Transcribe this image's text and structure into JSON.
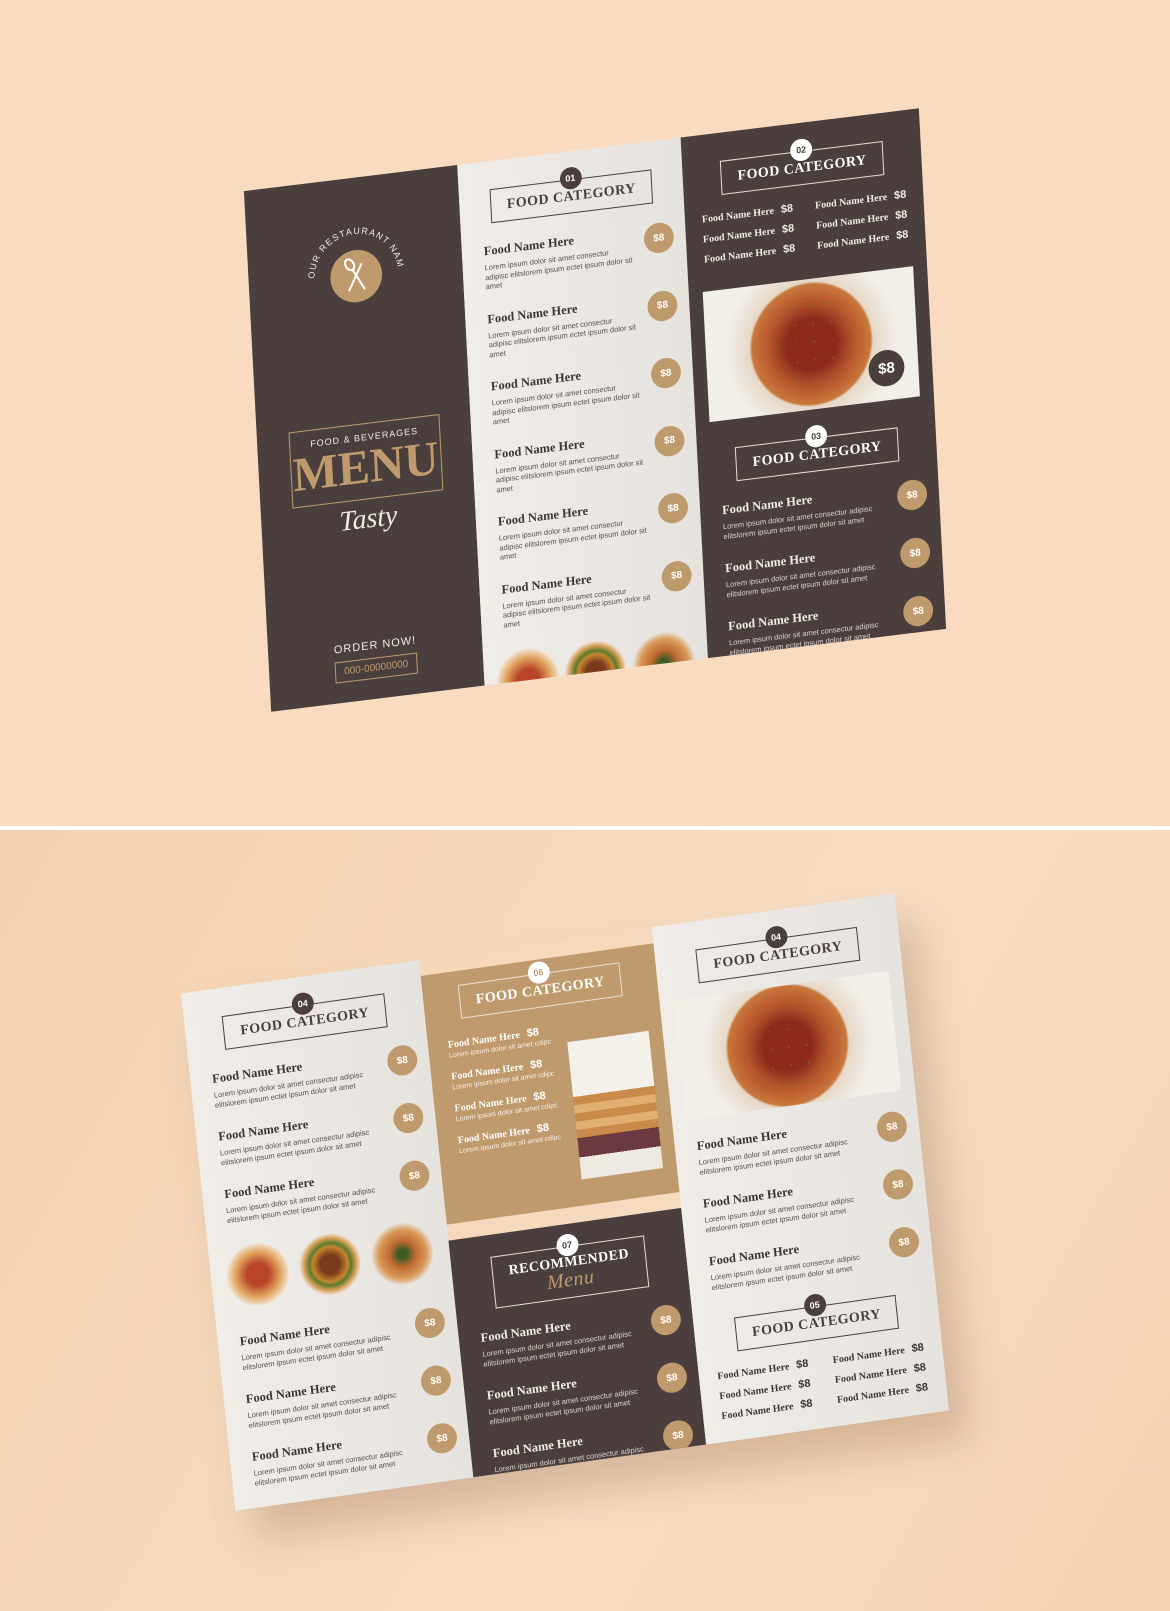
{
  "cover": {
    "restaurant_name": "YOUR RESTAURANT NAME",
    "subtitle": "FOOD & BEVERAGES",
    "title": "MENU",
    "script": "Tasty",
    "order_label": "ORDER NOW!",
    "phone": "000-00000000"
  },
  "common": {
    "food_category": "FOOD CATEGORY",
    "food_name": "Food Name Here",
    "price": "$8",
    "desc": "Lorem ipsum dolor sit amet consectur adipisc elitslorem ipsum ectet ipsum dolor sit amet",
    "desc_short": "Lorem ipsum dolor sit amet cdipc"
  },
  "numbers": {
    "n01": "01",
    "n02": "02",
    "n03": "03",
    "n04": "04",
    "n05": "05",
    "n06": "06",
    "n07": "07"
  },
  "recommended": {
    "title": "RECOMMENDED",
    "script": "Menu"
  },
  "pizza_price": "$8",
  "colors": {
    "dark": "#4a3f3c",
    "tan": "#bf9a6c",
    "light": "#ece8e3",
    "background": "#f9dcc0"
  },
  "icons": {
    "cover": "fork-spoon-icon"
  }
}
